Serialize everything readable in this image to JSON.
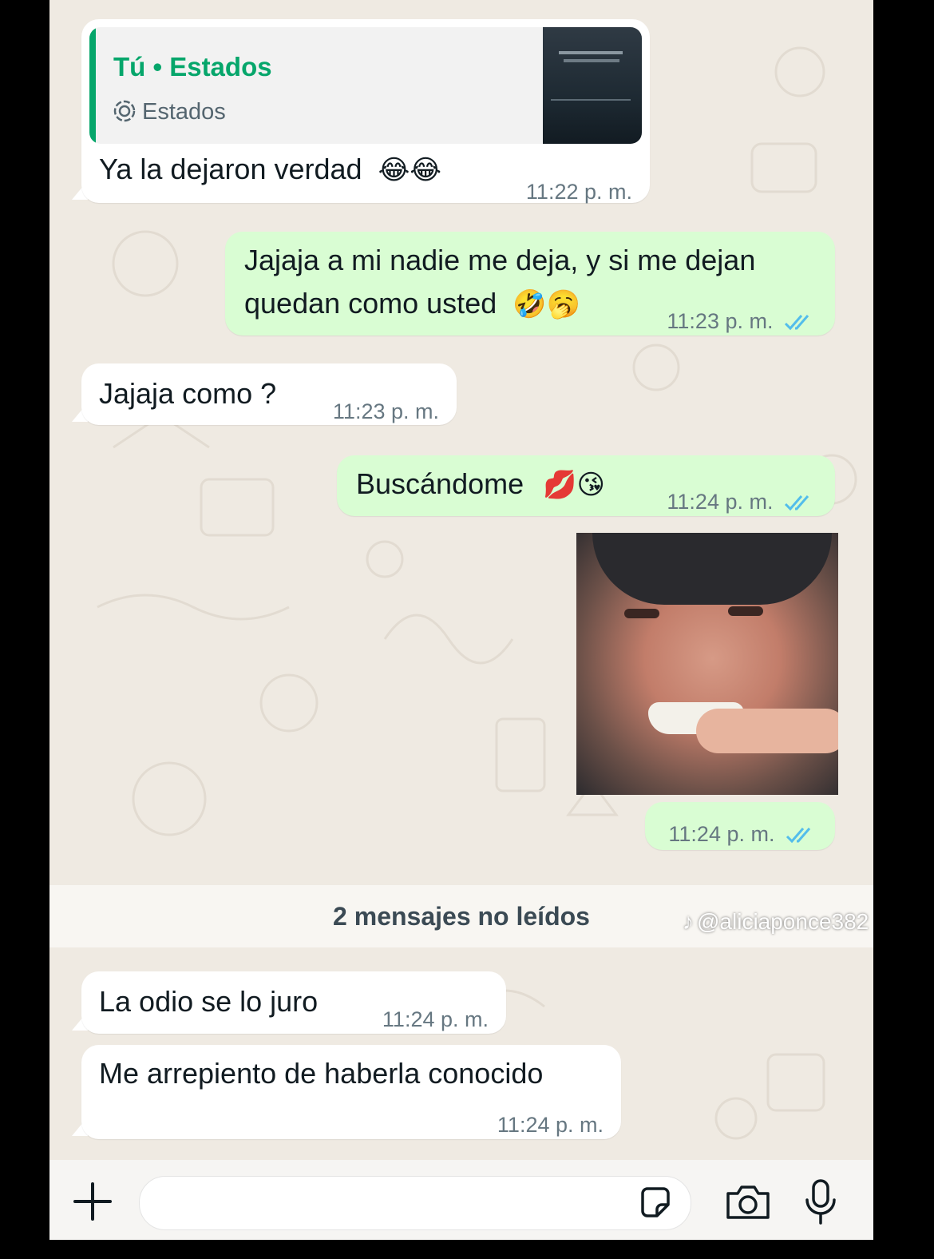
{
  "messages": {
    "m1": {
      "quote_author": "Tú • Estados",
      "quote_label": "Estados",
      "text": "Ya la dejaron verdad",
      "emoji": "😂😂",
      "time": "11:22 p. m."
    },
    "m2": {
      "line1": "Jajaja a mi nadie me deja, y si me dejan",
      "line2": "quedan como usted",
      "emoji": "🤣🥱",
      "time": "11:23 p. m."
    },
    "m3": {
      "text": "Jajaja como ?",
      "time": "11:23 p. m."
    },
    "m4": {
      "text": "Buscándome",
      "emoji": "💋😘",
      "time": "11:24 p. m."
    },
    "m5": {
      "time": "11:24 p. m."
    },
    "m6": {
      "text": "La odio se lo juro",
      "time": "11:24 p. m."
    },
    "m7": {
      "text": "Me arrepiento de haberla conocido",
      "time": "11:24 p. m."
    }
  },
  "unread_divider": "2 mensajes no leídos",
  "watermark": "@aliciaponce382",
  "colors": {
    "outgoing": "#d9fdd3",
    "incoming": "#ffffff",
    "read_ticks": "#53bdeb",
    "quote_accent": "#06a66b",
    "wallpaper": "#efeae2"
  },
  "icons": [
    "plus-icon",
    "sticker-icon",
    "camera-icon",
    "microphone-icon",
    "status-icon",
    "double-check-icon",
    "tiktok-icon"
  ]
}
